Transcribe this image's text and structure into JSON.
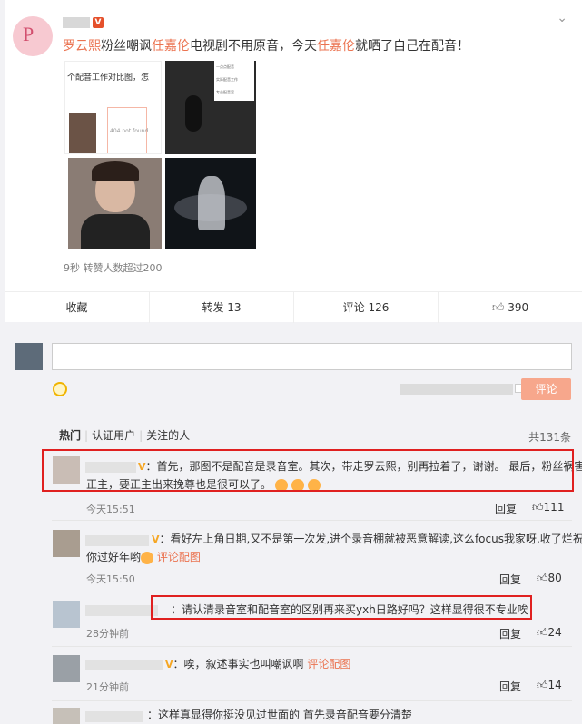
{
  "post": {
    "author_badge": "V",
    "text_link_1": "罗云熙",
    "text_part_1": "粉丝嘲讽",
    "text_link_2": "任嘉伦",
    "text_part_2": "电视剧不用原音，今天",
    "text_link_3": "任嘉伦",
    "text_part_3": "就晒了自己在配音！",
    "image_caption": "个配音工作对比图，怎",
    "image_404": "404 not found",
    "note_lines": [
      "一点点配音",
      "实际配音工作",
      "专业配音室",
      "录音设备"
    ],
    "meta": "9秒  转赞人数超过200",
    "actions": {
      "favorite": "收藏",
      "repost": "转发 13",
      "comment": "评论 126",
      "like": "390"
    }
  },
  "composer": {
    "submit": "评论"
  },
  "comment_tabs": {
    "hot": "热门",
    "verified": "认证用户",
    "followed": "关注的人",
    "total": "共131条"
  },
  "comments": [
    {
      "text_line_1": "：首先，那图不是配音是录音室。其次，带走罗云熙，别再拉着了，谢谢。 最后，粉丝祸害",
      "text_line_2": "正主，要正主出来挽尊也是很可以了。",
      "time": "今天15:51",
      "reply": "回复",
      "likes": "111"
    },
    {
      "text_line_1": "：看好左上角日期,又不是第一次发,进个录音棚就被恶意解读,这么focus我家呀,收了烂",
      "text_line_1b": "祝",
      "text_line_2": "你过好年哟",
      "view_image": "评论配图",
      "time": "今天15:50",
      "reply": "回复",
      "likes": "80"
    },
    {
      "text_line_1": "：请认清录音室和配音室的区别再来买yxh日路好吗？这样显得很不专业唉！",
      "time": "28分钟前",
      "reply": "回复",
      "likes": "24"
    },
    {
      "text_line_1": "：唉，叙述事实也叫嘲讽啊",
      "view_image": "评论配图",
      "time": "21分钟前",
      "reply": "回复",
      "likes": "14"
    },
    {
      "text_line_1": "：这样真显得你挺没见过世面的 首先录音配音要分清楚"
    }
  ]
}
